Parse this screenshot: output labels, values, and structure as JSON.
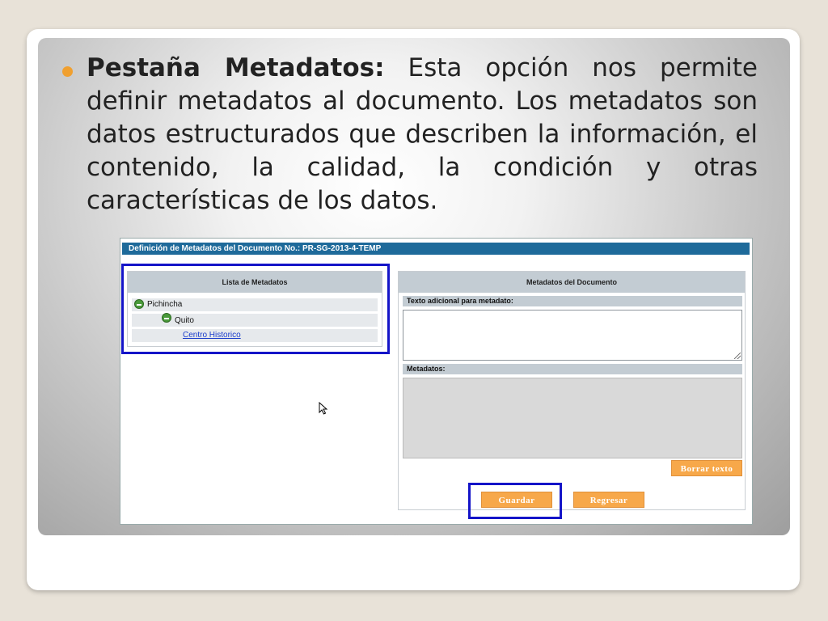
{
  "slide": {
    "bullet_bold": "Pestaña Metadatos:",
    "bullet_text": " Esta opción nos permite definir metadatos al documento. Los metadatos son datos estructurados que describen la información, el contenido, la calidad, la condición y otras características de los datos.",
    "accent_color": "#f0a030"
  },
  "app": {
    "header_title": "Definición de Metadatos del Documento No.: PR-SG-2013-4-TEMP",
    "header_color": "#1e6a9a",
    "left_panel": {
      "title": "Lista de Metadatos",
      "tree": [
        {
          "label": "Pichincha",
          "level": 0,
          "icon": "minus-circle-icon"
        },
        {
          "label": "Quito",
          "level": 1,
          "icon": "minus-circle-icon"
        },
        {
          "label": "Centro Historico",
          "level": 2,
          "link": true
        }
      ]
    },
    "right_panel": {
      "title": "Metadatos del Documento",
      "additional_text_label": "Texto adicional para metadato:",
      "metadata_label": "Metadatos:",
      "clear_button": "Borrar texto"
    },
    "buttons": {
      "save": "Guardar",
      "back": "Regresar"
    },
    "button_color": "#f7a84a",
    "highlight_color": "#1414c8"
  }
}
